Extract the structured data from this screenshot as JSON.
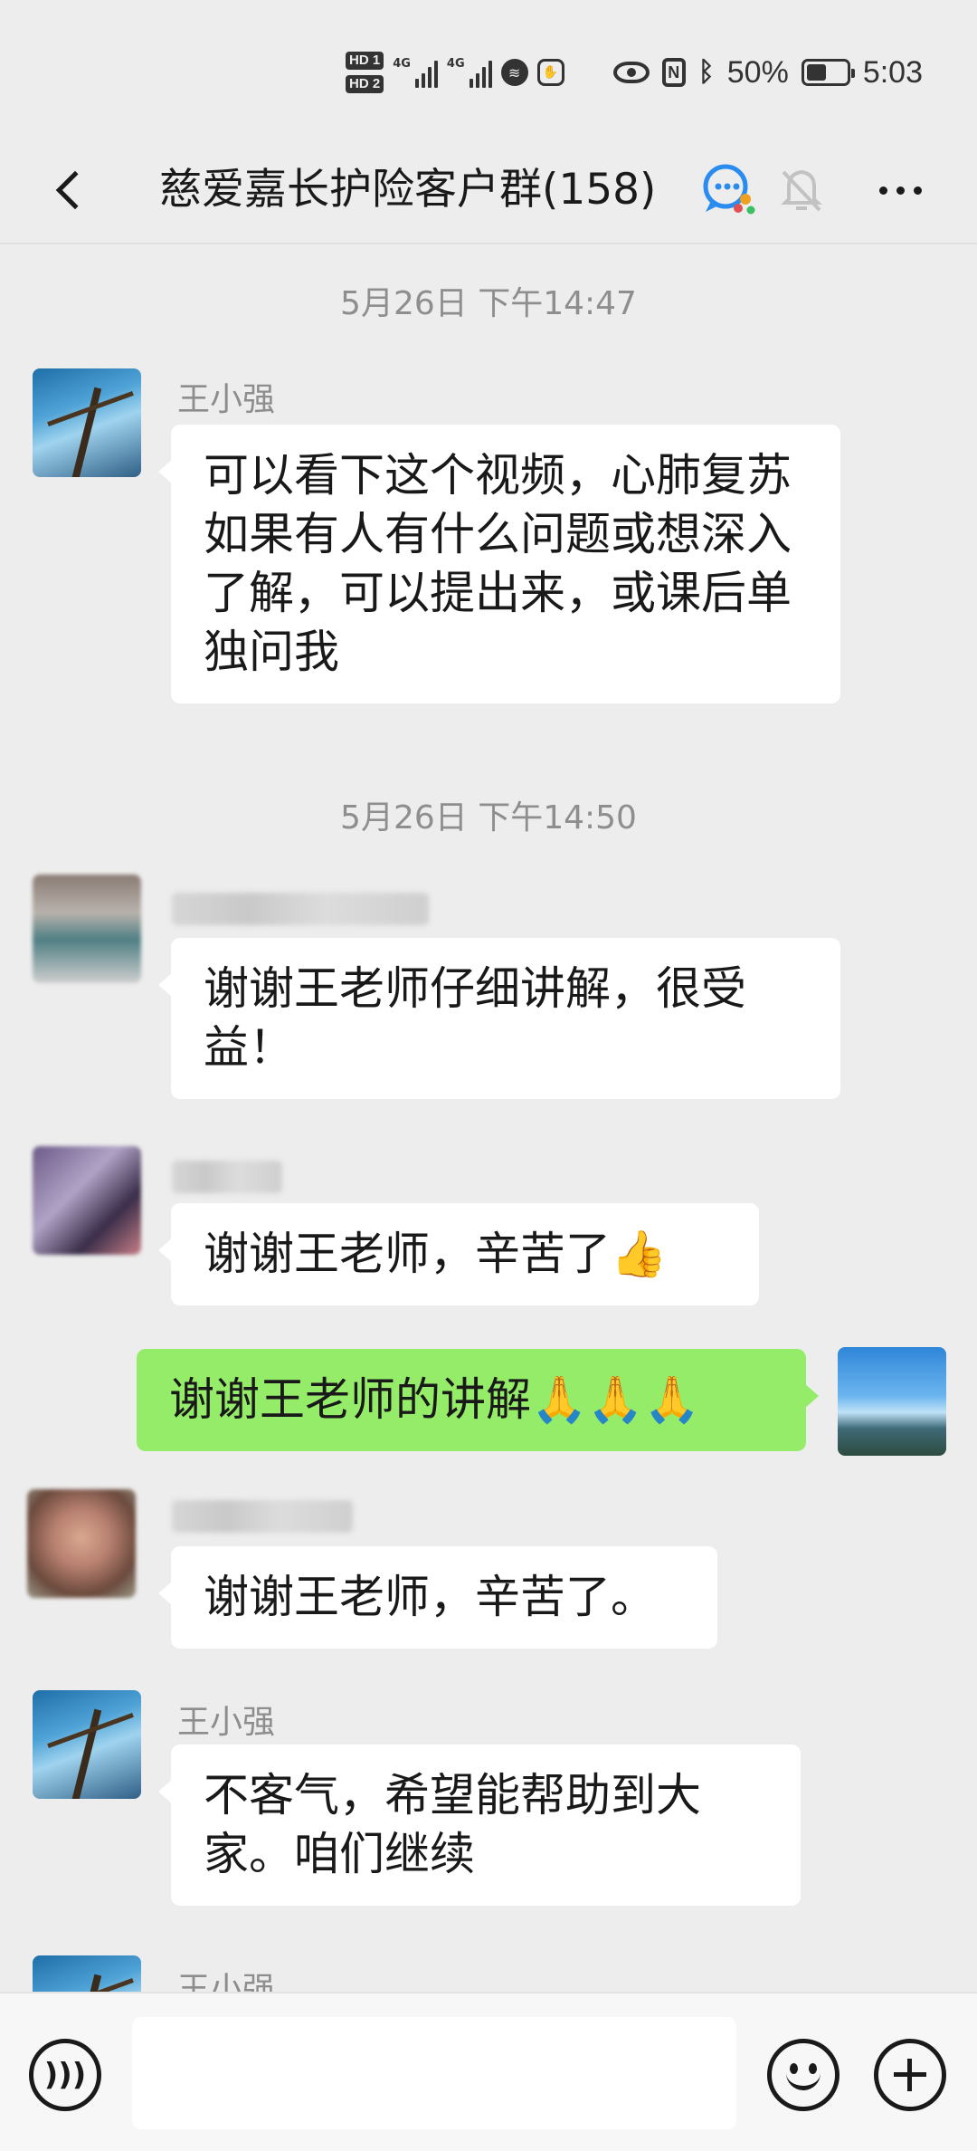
{
  "status_bar": {
    "hd1": "HD 1",
    "hd2": "HD 2",
    "net1": "4G",
    "net2": "4G",
    "battery_percent_text": "50%",
    "battery_level": 0.5,
    "time": "5:03",
    "icons": [
      "signal-icon",
      "signal-icon",
      "soundwave-icon",
      "hand-icon",
      "eye-icon",
      "nfc-icon",
      "bluetooth-icon",
      "battery-icon"
    ]
  },
  "header": {
    "title": "慈爱嘉长护险客户群(158)",
    "icons": [
      "back-icon",
      "chat-badge-icon",
      "mute-bell-icon",
      "more-icon"
    ]
  },
  "messages": [
    {
      "type": "timestamp",
      "text": "5月26日 下午14:47"
    },
    {
      "type": "incoming",
      "sender": "王小强",
      "text": "可以看下这个视频，心肺复苏如果有人有什么问题或想深入了解，可以提出来，或课后单独问我"
    },
    {
      "type": "timestamp",
      "text": "5月26日 下午14:50"
    },
    {
      "type": "incoming",
      "sender": "",
      "text": "谢谢王老师仔细讲解，很受益！"
    },
    {
      "type": "incoming",
      "sender": "",
      "text": "谢谢王老师，辛苦了👍"
    },
    {
      "type": "outgoing",
      "text": "谢谢王老师的讲解🙏🙏🙏"
    },
    {
      "type": "incoming",
      "sender": "",
      "text": "谢谢王老师，辛苦了。"
    },
    {
      "type": "incoming",
      "sender": "王小强",
      "text": "不客气，希望能帮助到大家。咱们继续"
    },
    {
      "type": "incoming",
      "sender": "王小强",
      "text": ""
    }
  ],
  "input_bar": {
    "value": "",
    "placeholder": "",
    "icons": [
      "voice-icon",
      "emoji-icon",
      "plus-icon"
    ]
  },
  "colors": {
    "background": "#ededed",
    "incoming_bubble": "#ffffff",
    "outgoing_bubble": "#95ec69",
    "meta_text": "#8e8e8e"
  }
}
